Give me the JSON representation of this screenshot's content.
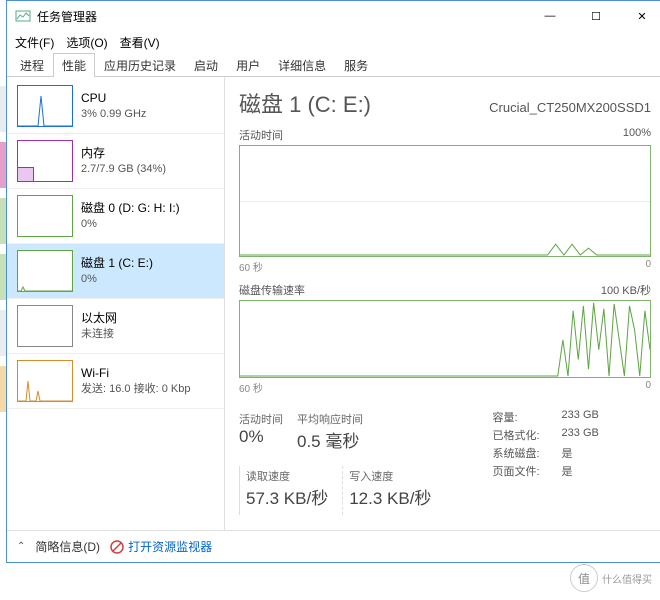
{
  "window": {
    "title": "任务管理器"
  },
  "window_controls": {
    "min": "—",
    "max": "☐",
    "close": "✕"
  },
  "menu": {
    "file": "文件(F)",
    "options": "选项(O)",
    "view": "查看(V)"
  },
  "tabs": [
    "进程",
    "性能",
    "应用历史记录",
    "启动",
    "用户",
    "详细信息",
    "服务"
  ],
  "active_tab": 1,
  "sidebar": [
    {
      "title": "CPU",
      "sub": "3% 0.99 GHz",
      "color": "#1a6fd8"
    },
    {
      "title": "内存",
      "sub": "2.7/7.9 GB (34%)",
      "color": "#9b2fae"
    },
    {
      "title": "磁盘 0 (D: G: H: I:)",
      "sub": "0%",
      "color": "#5fa544"
    },
    {
      "title": "磁盘 1 (C: E:)",
      "sub": "0%",
      "color": "#5fa544",
      "selected": true
    },
    {
      "title": "以太网",
      "sub": "未连接",
      "color": "#888"
    },
    {
      "title": "Wi-Fi",
      "sub": "发送: 16.0 接收: 0 Kbp",
      "color": "#d98a2b"
    }
  ],
  "main": {
    "title": "磁盘 1 (C: E:)",
    "model": "Crucial_CT250MX200SSD1",
    "chart1_label": "活动时间",
    "chart1_max": "100%",
    "chart2_label": "磁盘传输速率",
    "chart2_max": "100 KB/秒",
    "axis_left": "60 秒",
    "axis_right": "0",
    "stats": {
      "active_label": "活动时间",
      "active_val": "0%",
      "resp_label": "平均响应时间",
      "resp_val": "0.5 毫秒",
      "read_label": "读取速度",
      "read_val": "57.3 KB/秒",
      "write_label": "写入速度",
      "write_val": "12.3 KB/秒"
    },
    "info": {
      "capacity_k": "容量:",
      "capacity_v": "233 GB",
      "formatted_k": "已格式化:",
      "formatted_v": "233 GB",
      "sysdisk_k": "系统磁盘:",
      "sysdisk_v": "是",
      "pagefile_k": "页面文件:",
      "pagefile_v": "是"
    }
  },
  "footer": {
    "less": "简略信息(D)",
    "resmon": "打开资源监视器"
  },
  "watermark": {
    "text": "什么值得买",
    "icon": "值"
  },
  "chart_data": [
    {
      "type": "line",
      "title": "活动时间",
      "ylabel": "%",
      "ylim": [
        0,
        100
      ],
      "xlabel": "秒",
      "xlim": [
        60,
        0
      ],
      "values_estimate": "near-zero with small spikes (~5-8%) around t=45-50s"
    },
    {
      "type": "line",
      "title": "磁盘传输速率",
      "ylabel": "KB/秒",
      "ylim": [
        0,
        100
      ],
      "xlabel": "秒",
      "xlim": [
        60,
        0
      ],
      "values_estimate": "near-zero until ~t=12s then burst activity 20-100 KB/s"
    }
  ]
}
